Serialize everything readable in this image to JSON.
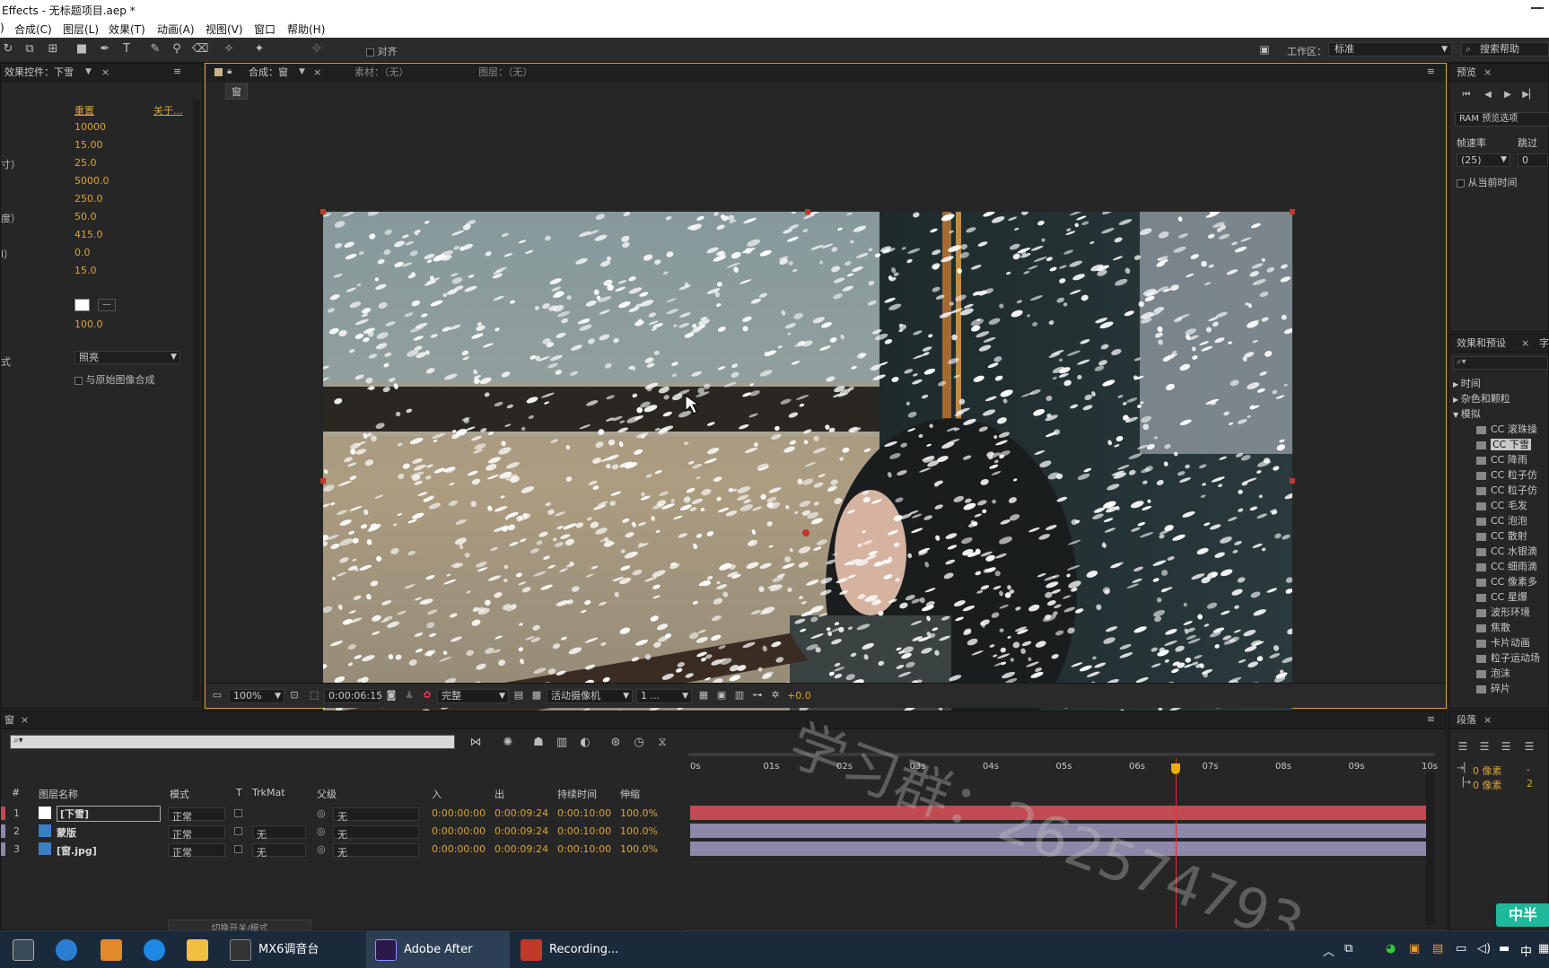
{
  "window": {
    "title": "Effects - 无标题项目.aep *"
  },
  "menu": [
    "合成(C)",
    "图层(L)",
    "效果(T)",
    "动画(A)",
    "视图(V)",
    "窗口",
    "帮助(H)"
  ],
  "toolbar": {
    "align_label": "对齐",
    "workspace_label": "工作区：",
    "workspace_value": "标准",
    "search_placeholder": "搜索帮助"
  },
  "effect_controls": {
    "tab": "效果控件：下雪",
    "reset": "重置",
    "about": "关于...",
    "rows": [
      {
        "label": "",
        "value": "10000"
      },
      {
        "label": "",
        "value": "15.00"
      },
      {
        "label": "寸）",
        "value": "25.0"
      },
      {
        "label": "",
        "value": "5000.0"
      },
      {
        "label": "",
        "value": "250.0"
      },
      {
        "label": "度）",
        "value": "50.0"
      },
      {
        "label": "",
        "value": "415.0"
      },
      {
        "label": "l）",
        "value": "0.0"
      },
      {
        "label": "",
        "value": "15.0"
      }
    ],
    "opacity_value": "100.0",
    "mode_label": "式",
    "mode_value": "照亮",
    "composite_label": "与原始图像合成"
  },
  "composition": {
    "tab": "合成：窗",
    "footage_tab": "素材：（无）",
    "layer_tab": "图层：（无）",
    "subtab": "窗",
    "zoom": "100%",
    "timecode": "0:00:06:15",
    "quality": "完整",
    "camera": "活动摄像机",
    "views": "1 ...",
    "exposure": "+0.0"
  },
  "preview": {
    "tab": "预览",
    "ram_options": "RAM 预览选项",
    "framerate_label": "帧速率",
    "skip_label": "跳过",
    "framerate_value": "(25)",
    "skip_value": "0",
    "from_current": "从当前时间"
  },
  "presets": {
    "tab": "效果和预设",
    "tab2": "字",
    "items": [
      {
        "label": "时间",
        "kind": "folder",
        "open": false
      },
      {
        "label": "杂色和颗粒",
        "kind": "folder",
        "open": false
      },
      {
        "label": "模拟",
        "kind": "folder",
        "open": true
      },
      {
        "label": "CC 滚珠操",
        "kind": "fx"
      },
      {
        "label": "CC 下雪",
        "kind": "fx",
        "selected": true
      },
      {
        "label": "CC 降雨",
        "kind": "fx"
      },
      {
        "label": "CC 粒子仿",
        "kind": "fx"
      },
      {
        "label": "CC 粒子仿",
        "kind": "fx"
      },
      {
        "label": "CC 毛发",
        "kind": "fx"
      },
      {
        "label": "CC 泡泡",
        "kind": "fx"
      },
      {
        "label": "CC 散射",
        "kind": "fx"
      },
      {
        "label": "CC 水银滴",
        "kind": "fx"
      },
      {
        "label": "CC 细雨滴",
        "kind": "fx"
      },
      {
        "label": "CC 像素多",
        "kind": "fx"
      },
      {
        "label": "CC 星爆",
        "kind": "fx"
      },
      {
        "label": "波形环境",
        "kind": "fx"
      },
      {
        "label": "焦散",
        "kind": "fx"
      },
      {
        "label": "卡片动画",
        "kind": "fx"
      },
      {
        "label": "粒子运动场",
        "kind": "fx"
      },
      {
        "label": "泡沫",
        "kind": "fx"
      },
      {
        "label": "碎片",
        "kind": "fx"
      }
    ]
  },
  "timeline": {
    "tab": "窗",
    "columns": {
      "num": "#",
      "name": "图层名称",
      "mode": "模式",
      "t": "T",
      "trkmat": "TrkMat",
      "parent": "父级",
      "in": "入",
      "out": "出",
      "duration": "持续时间",
      "stretch": "伸缩"
    },
    "ruler": [
      "0s",
      "01s",
      "02s",
      "03s",
      "04s",
      "05s",
      "06s",
      "07s",
      "08s",
      "09s",
      "10s"
    ],
    "layers": [
      {
        "num": "1",
        "name": "[下雪]",
        "mode": "正常",
        "trkmat": "",
        "parent": "无",
        "in": "0:00:00:00",
        "out": "0:00:09:24",
        "duration": "0:00:10:00",
        "stretch": "100.0%",
        "color": "#c24a52"
      },
      {
        "num": "2",
        "name": "蒙版",
        "mode": "正常",
        "trkmat": "无",
        "parent": "无",
        "in": "0:00:00:00",
        "out": "0:00:09:24",
        "duration": "0:00:10:00",
        "stretch": "100.0%",
        "color": "#8d87a8"
      },
      {
        "num": "3",
        "name": "[窗.jpg]",
        "mode": "正常",
        "trkmat": "无",
        "parent": "无",
        "in": "0:00:00:00",
        "out": "0:00:09:24",
        "duration": "0:00:10:00",
        "stretch": "100.0%",
        "color": "#8d87a8"
      }
    ],
    "footer": "切换开关/模式",
    "playhead_fraction": 0.66
  },
  "paragraph": {
    "tab": "段落",
    "px1": "0 像素",
    "px2": "0 像素",
    "v1": "-",
    "v2": "2"
  },
  "taskbar": {
    "items": [
      {
        "label": "MX6调音台"
      },
      {
        "label": "Adobe After Effec..."
      },
      {
        "label": "Recording..."
      }
    ],
    "tray_lang": "中"
  },
  "watermark": "学习群：2625747​93",
  "badge": "中半"
}
